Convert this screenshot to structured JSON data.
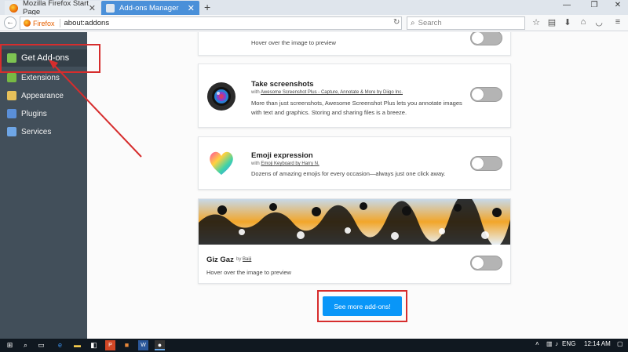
{
  "tabs": [
    {
      "title": "Mozilla Firefox Start Page"
    },
    {
      "title": "Add-ons Manager"
    }
  ],
  "window": {
    "minimize": "—",
    "maximize": "❐",
    "close": "✕",
    "new_tab": "+"
  },
  "navbar": {
    "url_brand": "Firefox",
    "url": "about:addons",
    "search_placeholder": "Search"
  },
  "sidebar": {
    "items": [
      {
        "label": "Get Add-ons",
        "icon": "get-addons-icon",
        "active": true
      },
      {
        "label": "Extensions",
        "icon": "puzzle-icon"
      },
      {
        "label": "Appearance",
        "icon": "palette-icon"
      },
      {
        "label": "Plugins",
        "icon": "plugin-icon"
      },
      {
        "label": "Services",
        "icon": "services-icon"
      }
    ]
  },
  "addons": [
    {
      "title": "Take screenshots",
      "by_prefix": "with",
      "author": "Awesome Screenshot Plus - Capture, Annotate & More by Diigo Inc.",
      "desc": "More than just screenshots, Awesome Screenshot Plus lets you annotate images with text and graphics. Storing and sharing files is a breeze."
    },
    {
      "title": "Emoji expression",
      "by_prefix": "with",
      "author": "Emoji Keyboard by Harry N.",
      "desc": "Dozens of amazing emojis for every occasion—always just one click away."
    },
    {
      "title": "Giz Gaz",
      "by_prefix": "by",
      "author": "Baiji",
      "desc": "Hover over the image to preview"
    }
  ],
  "top_card": {
    "desc": "Hover over the image to preview"
  },
  "see_more": "See more add-ons!",
  "taskbar": {
    "lang": "ENG",
    "time": "12:14 AM"
  },
  "colors": {
    "accent": "#0996f8",
    "highlight": "#d62d2d",
    "sidebar": "#424f5a"
  }
}
